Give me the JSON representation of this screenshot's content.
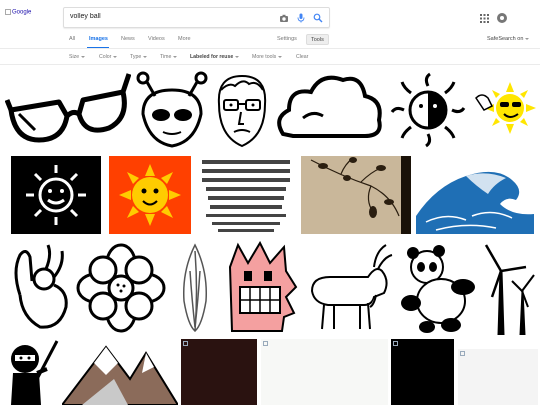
{
  "logo": {
    "alt": "Google"
  },
  "search": {
    "query": "volley ball"
  },
  "tabs": [
    {
      "label": "All"
    },
    {
      "label": "Images"
    },
    {
      "label": "News"
    },
    {
      "label": "Videos"
    },
    {
      "label": "More"
    }
  ],
  "tools": {
    "settings": "Settings",
    "tools": "Tools",
    "safesearch": "SafeSearch on"
  },
  "filters": {
    "size": "Size",
    "color": "Color",
    "type": "Type",
    "time": "Time",
    "license": "Labeled for reuse",
    "more_tools": "More tools",
    "clear": "Clear"
  },
  "colors": {
    "accent": "#1a73e8",
    "link": "#1a0dab"
  },
  "results": [
    {
      "name": "sunglasses-clipart"
    },
    {
      "name": "alien-head-clipart"
    },
    {
      "name": "man-with-glasses-clipart"
    },
    {
      "name": "cloud-clipart"
    },
    {
      "name": "sun-moon-clipart"
    },
    {
      "name": "cool-sun-clipart"
    },
    {
      "name": "black-sun-clipart"
    },
    {
      "name": "orange-sun-clipart"
    },
    {
      "name": "alphabet-chart-image"
    },
    {
      "name": "plant-silhouette-image"
    },
    {
      "name": "great-wave-image"
    },
    {
      "name": "ok-hand-clipart"
    },
    {
      "name": "flower-outline-clipart"
    },
    {
      "name": "tulip-bud-clipart"
    },
    {
      "name": "pink-monster-clipart"
    },
    {
      "name": "goat-clipart"
    },
    {
      "name": "panda-clipart"
    },
    {
      "name": "wind-turbines-clipart"
    },
    {
      "name": "ninja-clipart"
    },
    {
      "name": "mountains-clipart"
    },
    {
      "name": "dark-image-placeholder"
    },
    {
      "name": "light-image-placeholder"
    },
    {
      "name": "black-image-placeholder"
    },
    {
      "name": "loading-image-placeholder"
    }
  ]
}
